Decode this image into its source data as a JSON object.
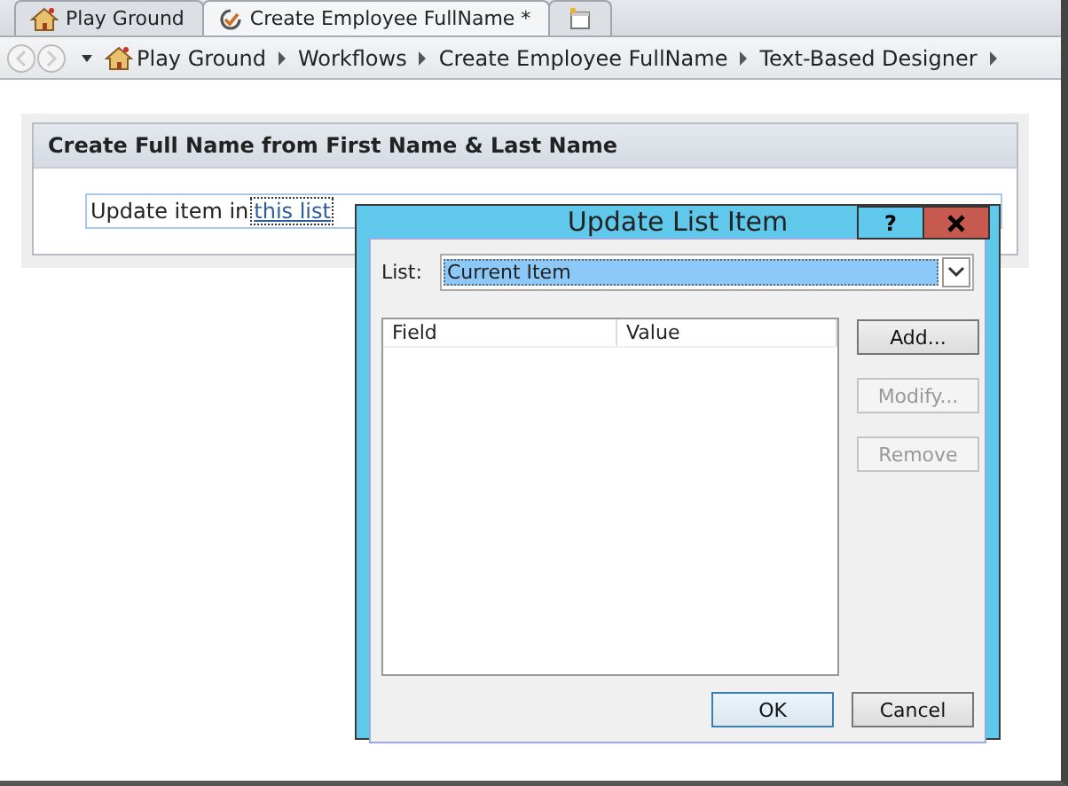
{
  "tabs": [
    {
      "kind": "site",
      "label": "Play Ground",
      "selected": false
    },
    {
      "kind": "workflow",
      "label": "Create Employee FullName *",
      "selected": true
    },
    {
      "kind": "new",
      "selected": false
    }
  ],
  "breadcrumb": [
    "Play Ground",
    "Workflows",
    "Create Employee FullName",
    "Text-Based Designer"
  ],
  "step": {
    "title": "Create Full Name from First Name & Last Name",
    "text": "Update item in",
    "link": "this list"
  },
  "dialog": {
    "title": "Update List Item",
    "help": "?",
    "list_label": "List:",
    "list_value": "Current Item",
    "columns": [
      "Field",
      "Value"
    ],
    "side_buttons": [
      {
        "label": "Add...",
        "disabled": false
      },
      {
        "label": "Modify...",
        "disabled": true
      },
      {
        "label": "Remove",
        "disabled": true
      }
    ],
    "footer_buttons": [
      {
        "label": "OK",
        "default": true
      },
      {
        "label": "Cancel",
        "default": false
      }
    ]
  }
}
